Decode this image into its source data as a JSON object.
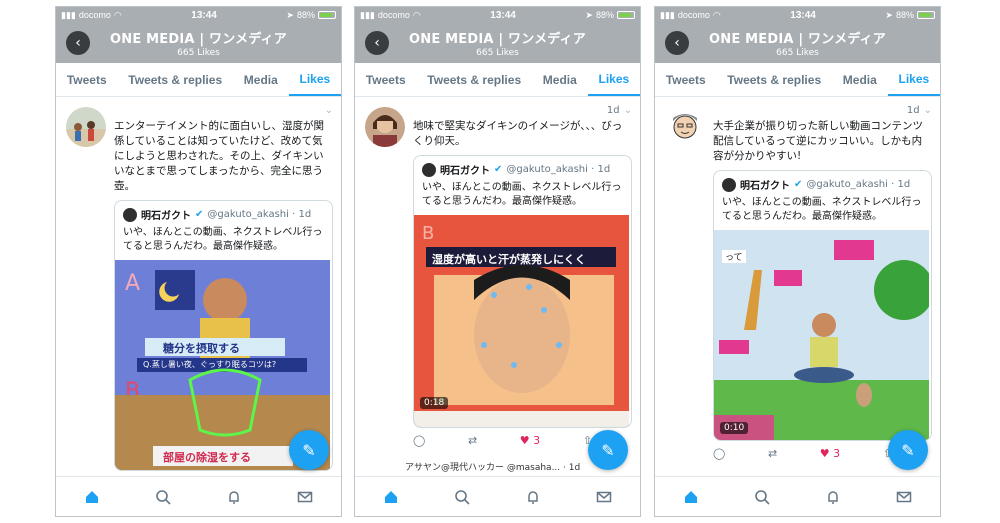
{
  "status": {
    "carrier": "docomo",
    "time": "13:44",
    "battery": "88%"
  },
  "header": {
    "title": "ONE MEDIA | ワンメディア",
    "subtitle": "665 Likes"
  },
  "tabs": [
    "Tweets",
    "Tweets & replies",
    "Media",
    "Likes"
  ],
  "colors": {
    "accent": "#1da1f2",
    "header_bg": "#a9aeb3",
    "like": "#e0245e"
  },
  "phones": [
    {
      "tweet_time": "",
      "text": "エンターテイメント的に面白いし、湿度が関係していることは知っていたけど、改めて気にしようと思わされた。その上、ダイキンいいなとまで思ってしまったから、完全に思う壺。",
      "quote": {
        "name": "明石ガクト",
        "handle": "@gakuto_akashi · 1d",
        "text": "いや、ほんとこの動画、ネクストレベル行ってると思うんだわ。最高傑作疑惑。"
      },
      "media": {
        "caption1": "糖分を摂取する",
        "caption2": "Q.蒸し暑い夜、ぐっすり眠るコツは?",
        "caption3": "部屋の除湿をする"
      }
    },
    {
      "tweet_time": "1d",
      "text": "地味で堅実なダイキンのイメージが、、、びっくり仰天。",
      "quote": {
        "name": "明石ガクト",
        "handle": "@gakuto_akashi · 1d",
        "text": "いや、ほんとこの動画、ネクストレベル行ってると思うんだわ。最高傑作疑惑。"
      },
      "media": {
        "caption1": "湿度が高いと汗が蒸発しにくく",
        "duration": "0:18"
      },
      "likes": "3",
      "next_author": "アサヤン@現代ハッカー @masaha... · 1d"
    },
    {
      "tweet_time": "1d",
      "text": "大手企業が振り切った新しい動画コンテンツ配信しているって逆にカッコいい。しかも内容が分かりやすい!",
      "quote": {
        "name": "明石ガクト",
        "handle": "@gakuto_akashi · 1d",
        "text": "いや、ほんとこの動画、ネクストレベル行ってると思うんだわ。最高傑作疑惑。"
      },
      "media": {
        "caption1": "って",
        "duration": "0:10"
      },
      "likes": "3"
    }
  ]
}
